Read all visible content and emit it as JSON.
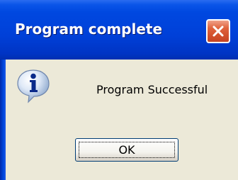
{
  "dialog": {
    "title": "Program complete",
    "message": "Program Successful",
    "ok_label": "OK",
    "icon": "info-icon",
    "close_icon": "close-icon"
  },
  "colors": {
    "titlebar": "#0040d8",
    "close_button": "#d9573a",
    "dialog_background": "#ece9d8",
    "title_text": "#ffffff"
  }
}
